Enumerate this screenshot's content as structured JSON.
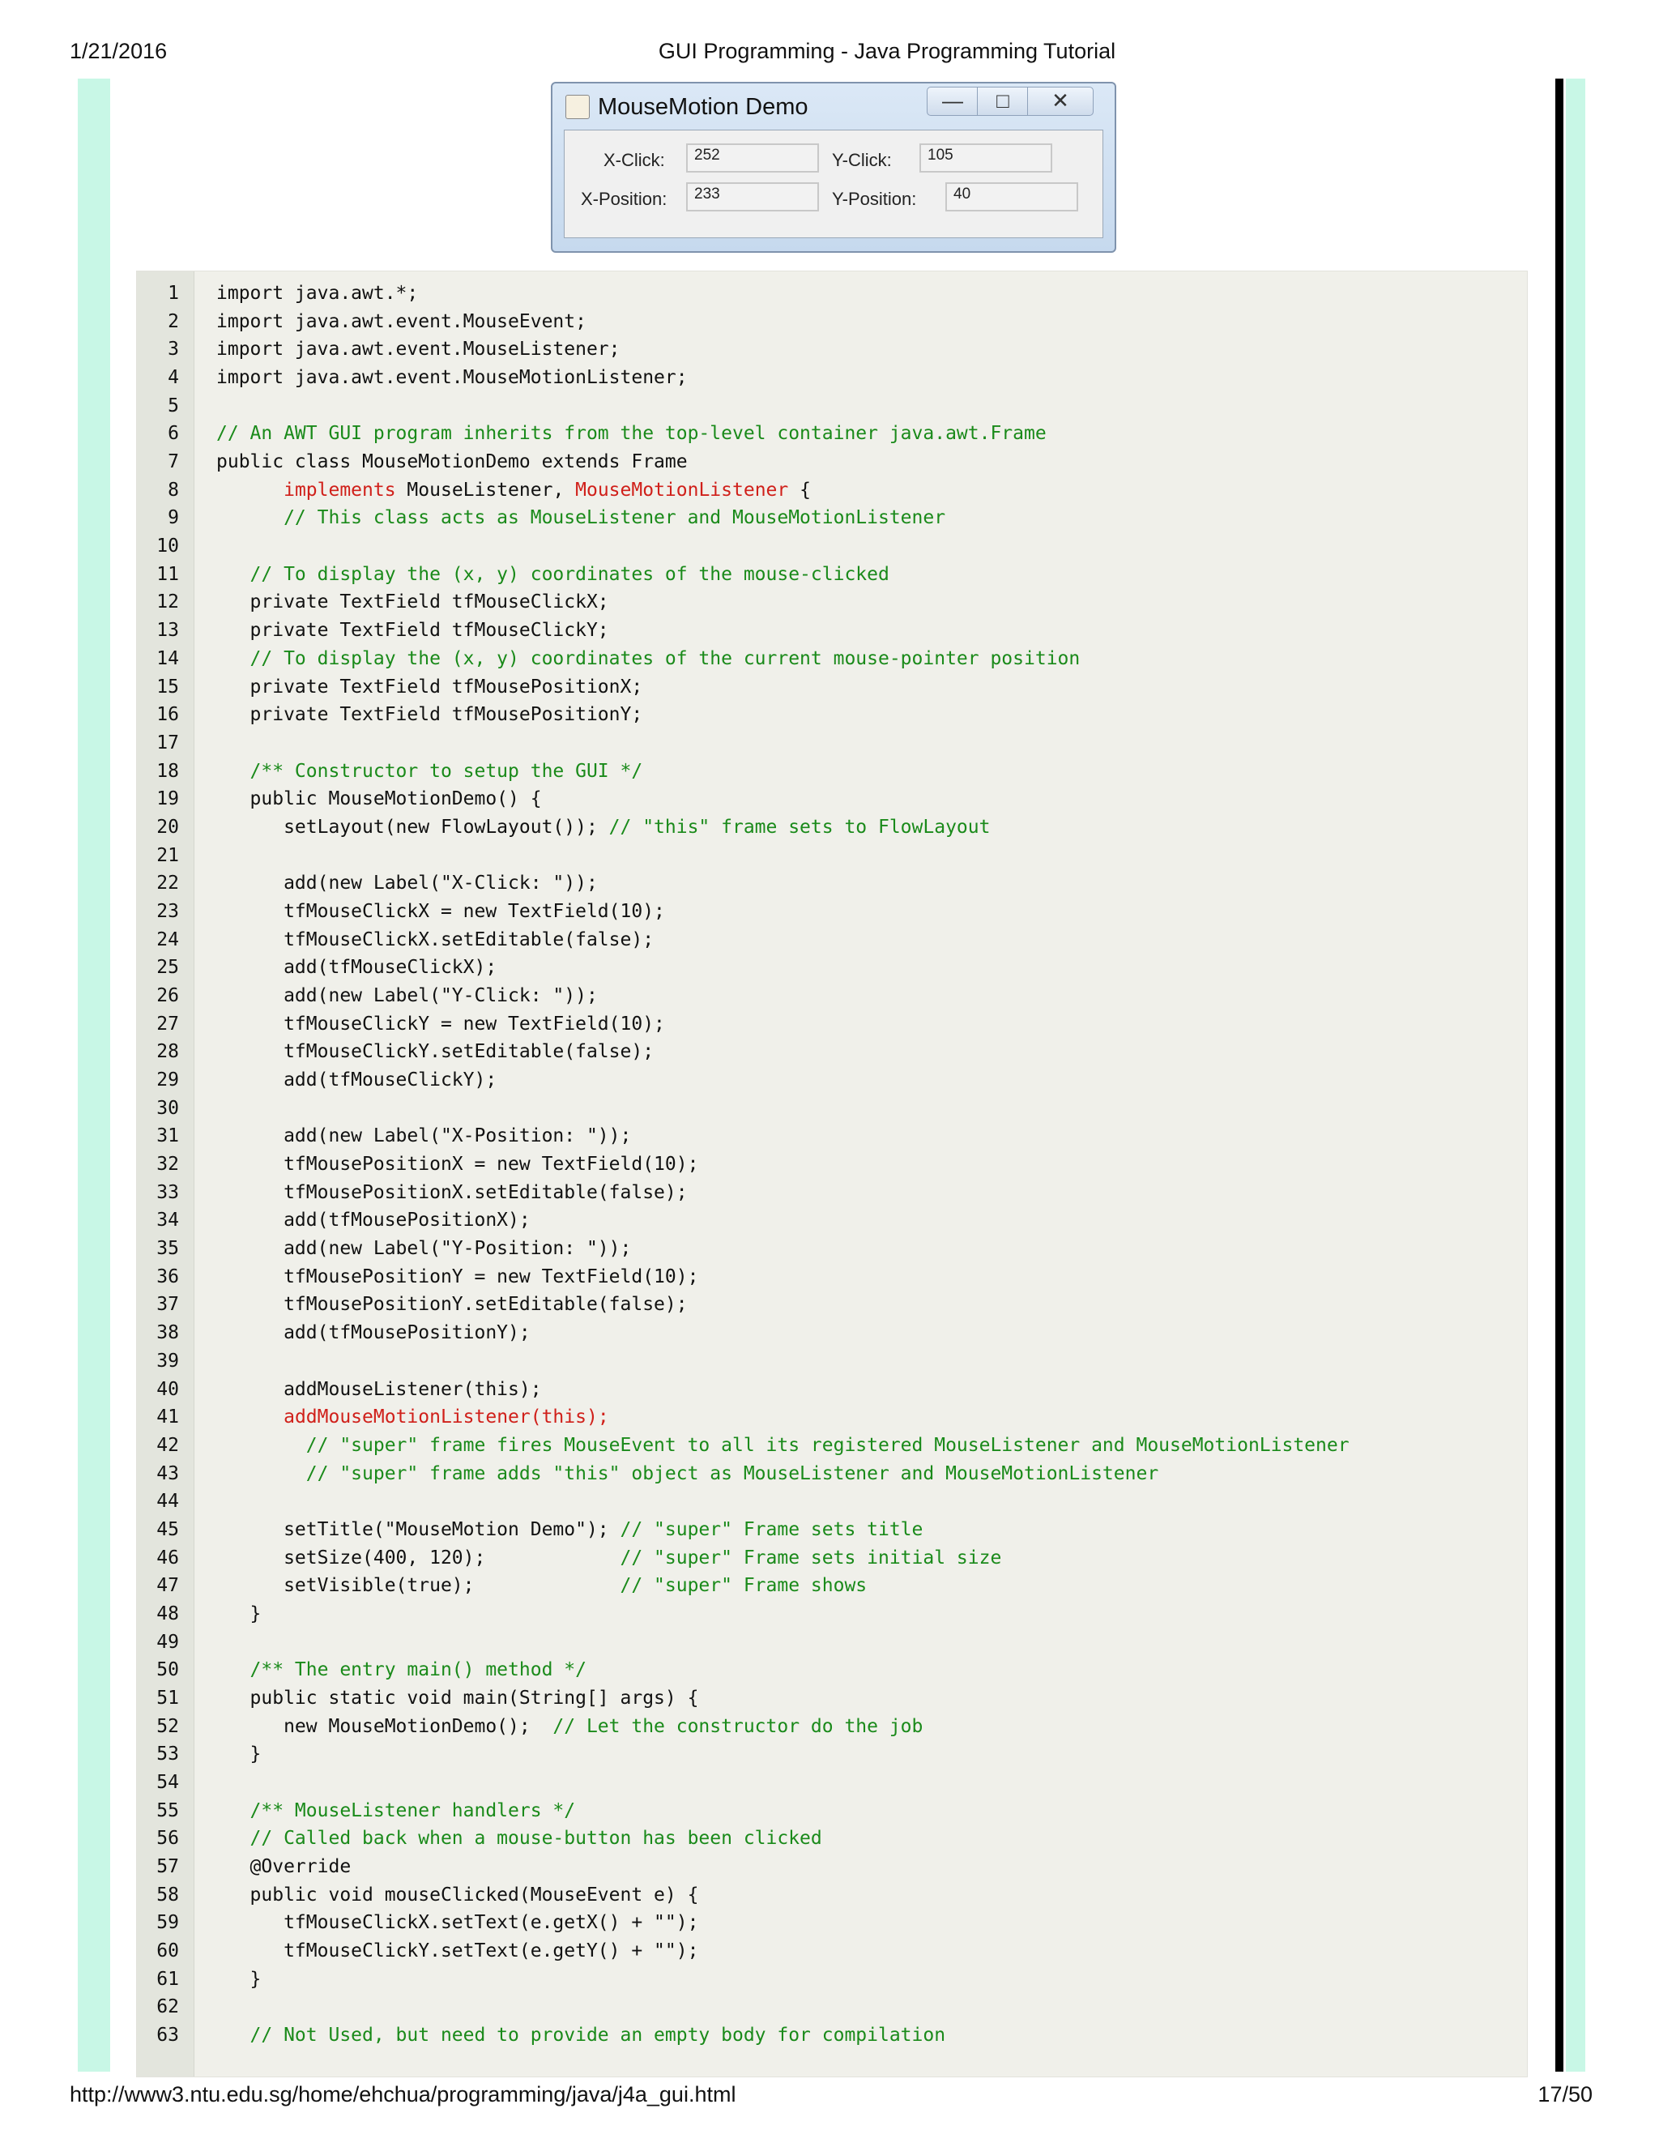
{
  "header": {
    "date": "1/21/2016",
    "title": "GUI Programming - Java Programming Tutorial"
  },
  "footer": {
    "url": "http://www3.ntu.edu.sg/home/ehchua/programming/java/j4a_gui.html",
    "page": "17/50"
  },
  "demo_window": {
    "title": "MouseMotion Demo",
    "controls": {
      "minimize": "—",
      "maximize": "□",
      "close": "✕"
    },
    "x_click_label": "X-Click:",
    "x_click_value": "252",
    "y_click_label": "Y-Click:",
    "y_click_value": "105",
    "x_position_label": "X-Position:",
    "x_position_value": "233",
    "y_position_label": "Y-Position:",
    "y_position_value": "40"
  },
  "code": {
    "lines": [
      [
        {
          "t": "import java.awt.*;"
        }
      ],
      [
        {
          "t": "import java.awt.event.MouseEvent;"
        }
      ],
      [
        {
          "t": "import java.awt.event.MouseListener;"
        }
      ],
      [
        {
          "t": "import java.awt.event.MouseMotionListener;"
        }
      ],
      [],
      [
        {
          "t": "// An AWT GUI program inherits from the top-level container java.awt.Frame",
          "s": "cm"
        }
      ],
      [
        {
          "t": "public class MouseMotionDemo extends Frame"
        }
      ],
      [
        {
          "t": "      "
        },
        {
          "t": "implements",
          "s": "kw"
        },
        {
          "t": " MouseListener, "
        },
        {
          "t": "MouseMotionListener",
          "s": "kw"
        },
        {
          "t": " {"
        }
      ],
      [
        {
          "t": "      // This class acts as MouseListener and MouseMotionListener",
          "s": "cm"
        }
      ],
      [],
      [
        {
          "t": "   // To display the (x, y) coordinates of the mouse-clicked",
          "s": "cm"
        }
      ],
      [
        {
          "t": "   private TextField tfMouseClickX;"
        }
      ],
      [
        {
          "t": "   private TextField tfMouseClickY;"
        }
      ],
      [
        {
          "t": "   // To display the (x, y) coordinates of the current mouse-pointer position",
          "s": "cm"
        }
      ],
      [
        {
          "t": "   private TextField tfMousePositionX;"
        }
      ],
      [
        {
          "t": "   private TextField tfMousePositionY;"
        }
      ],
      [],
      [
        {
          "t": "   /** Constructor to setup the GUI */",
          "s": "cm"
        }
      ],
      [
        {
          "t": "   public MouseMotionDemo() {"
        }
      ],
      [
        {
          "t": "      setLayout(new FlowLayout()); "
        },
        {
          "t": "// \"this\" frame sets to FlowLayout",
          "s": "cm"
        }
      ],
      [],
      [
        {
          "t": "      add(new Label(\"X-Click: \"));"
        }
      ],
      [
        {
          "t": "      tfMouseClickX = new TextField(10);"
        }
      ],
      [
        {
          "t": "      tfMouseClickX.setEditable(false);"
        }
      ],
      [
        {
          "t": "      add(tfMouseClickX);"
        }
      ],
      [
        {
          "t": "      add(new Label(\"Y-Click: \"));"
        }
      ],
      [
        {
          "t": "      tfMouseClickY = new TextField(10);"
        }
      ],
      [
        {
          "t": "      tfMouseClickY.setEditable(false);"
        }
      ],
      [
        {
          "t": "      add(tfMouseClickY);"
        }
      ],
      [],
      [
        {
          "t": "      add(new Label(\"X-Position: \"));"
        }
      ],
      [
        {
          "t": "      tfMousePositionX = new TextField(10);"
        }
      ],
      [
        {
          "t": "      tfMousePositionX.setEditable(false);"
        }
      ],
      [
        {
          "t": "      add(tfMousePositionX);"
        }
      ],
      [
        {
          "t": "      add(new Label(\"Y-Position: \"));"
        }
      ],
      [
        {
          "t": "      tfMousePositionY = new TextField(10);"
        }
      ],
      [
        {
          "t": "      tfMousePositionY.setEditable(false);"
        }
      ],
      [
        {
          "t": "      add(tfMousePositionY);"
        }
      ],
      [],
      [
        {
          "t": "      addMouseListener(this);"
        }
      ],
      [
        {
          "t": "      "
        },
        {
          "t": "addMouseMotionListener(this);",
          "s": "kw"
        }
      ],
      [
        {
          "t": "        // \"super\" frame fires MouseEvent to all its registered MouseListener and MouseMotionListener",
          "s": "cm"
        }
      ],
      [
        {
          "t": "        // \"super\" frame adds \"this\" object as MouseListener and MouseMotionListener",
          "s": "cm"
        }
      ],
      [],
      [
        {
          "t": "      setTitle(\"MouseMotion Demo\"); "
        },
        {
          "t": "// \"super\" Frame sets title",
          "s": "cm"
        }
      ],
      [
        {
          "t": "      setSize(400, 120);            "
        },
        {
          "t": "// \"super\" Frame sets initial size",
          "s": "cm"
        }
      ],
      [
        {
          "t": "      setVisible(true);             "
        },
        {
          "t": "// \"super\" Frame shows",
          "s": "cm"
        }
      ],
      [
        {
          "t": "   }"
        }
      ],
      [],
      [
        {
          "t": "   /** The entry main() method */",
          "s": "cm"
        }
      ],
      [
        {
          "t": "   public static void main(String[] args) {"
        }
      ],
      [
        {
          "t": "      new MouseMotionDemo();  "
        },
        {
          "t": "// Let the constructor do the job",
          "s": "cm"
        }
      ],
      [
        {
          "t": "   }"
        }
      ],
      [],
      [
        {
          "t": "   /** MouseListener handlers */",
          "s": "cm"
        }
      ],
      [
        {
          "t": "   // Called back when a mouse-button has been clicked",
          "s": "cm"
        }
      ],
      [
        {
          "t": "   @Override"
        }
      ],
      [
        {
          "t": "   public void mouseClicked(MouseEvent e) {"
        }
      ],
      [
        {
          "t": "      tfMouseClickX.setText(e.getX() + \"\");"
        }
      ],
      [
        {
          "t": "      tfMouseClickY.setText(e.getY() + \"\");"
        }
      ],
      [
        {
          "t": "   }"
        }
      ],
      [],
      [
        {
          "t": "   // Not Used, but need to provide an empty body for compilation",
          "s": "cm"
        }
      ]
    ]
  }
}
